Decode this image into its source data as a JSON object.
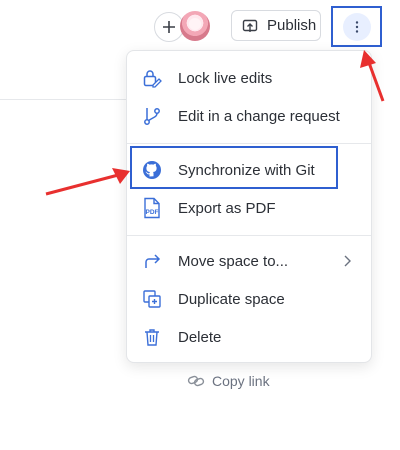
{
  "toolbar": {
    "add_icon": "plus-icon",
    "avatar_icon": "user-avatar",
    "publish_label": "Publish",
    "publish_icon": "publish-icon",
    "more_icon": "vertical-dots-icon"
  },
  "menu": {
    "items": [
      {
        "label": "Lock live edits",
        "icon": "lock-edit-icon"
      },
      {
        "label": "Edit in a change request",
        "icon": "branch-icon"
      },
      {
        "label": "Synchronize with Git",
        "icon": "github-icon"
      },
      {
        "label": "Export as PDF",
        "icon": "pdf-icon"
      },
      {
        "label": "Move space to...",
        "icon": "move-arrow-icon"
      },
      {
        "label": "Duplicate space",
        "icon": "duplicate-icon"
      },
      {
        "label": "Delete",
        "icon": "trash-icon"
      }
    ]
  },
  "footer": {
    "copy_link_label": "Copy link",
    "copy_link_icon": "link-icon"
  },
  "colors": {
    "accent": "#2f5fd0",
    "icon": "#3b6fd8",
    "annotation_arrow": "#e8302f"
  }
}
